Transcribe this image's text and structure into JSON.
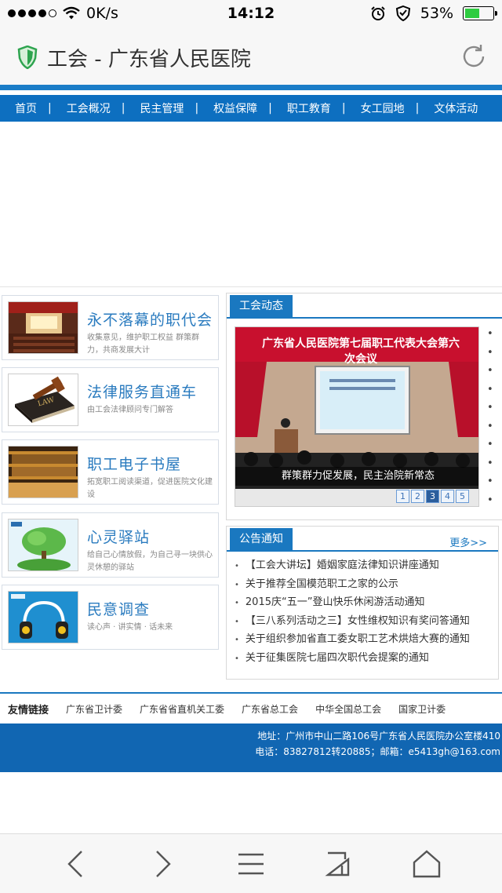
{
  "status": {
    "speed": "0K/s",
    "time": "14:12",
    "battery": "53%",
    "battery_level": 0.53
  },
  "browser": {
    "title": "工会 - 广东省人民医院"
  },
  "nav": [
    "首页",
    "工会概况",
    "民主管理",
    "权益保障",
    "职工教育",
    "女工园地",
    "文体活动"
  ],
  "cards": [
    {
      "title": "永不落幕的职代会",
      "sub": "收集意见，维护职工权益 群策群力，共商发展大计"
    },
    {
      "title": "法律服务直通车",
      "sub": "由工会法律顾问专门解答"
    },
    {
      "title": "职工电子书屋",
      "sub": "拓宽职工阅读渠道，促进医院文化建设"
    },
    {
      "title": "心灵驿站",
      "sub": "给自己心情放假，为自己寻一块供心灵休憩的驿站"
    },
    {
      "title": "民意调查",
      "sub": "读心声 · 讲实情 · 话未来"
    }
  ],
  "news": {
    "tab": "工会动态",
    "photo_banner": "广东省人民医院第七届职工代表大会第六次会议",
    "caption": "群策群力促发展，民主治院新常态",
    "pages": [
      "1",
      "2",
      "3",
      "4",
      "5"
    ],
    "active_page": "3"
  },
  "notice": {
    "tab": "公告通知",
    "more": "更多>>",
    "items": [
      "【工会大讲坛】婚姻家庭法律知识讲座通知",
      "关于推荐全国模范职工之家的公示",
      "2015庆“五一”登山快乐休闲游活动通知",
      "【三八系列活动之三】女性维权知识有奖问答通知",
      "关于组织参加省直工委女职工艺术烘焙大赛的通知",
      "关于征集医院七届四次职代会提案的通知"
    ]
  },
  "links": {
    "label": "友情链接",
    "items": [
      "广东省卫计委",
      "广东省省直机关工委",
      "广东省总工会",
      "中华全国总工会",
      "国家卫计委"
    ]
  },
  "footer": {
    "address": "地址：广州市中山二路106号广东省人民医院办公室楼410",
    "contact": "电话：83827812转20885；邮箱：e5413gh@163.com"
  },
  "colors": {
    "nav": "#0d6fc0",
    "accent": "#1a78c0",
    "footer": "#1166b2"
  }
}
